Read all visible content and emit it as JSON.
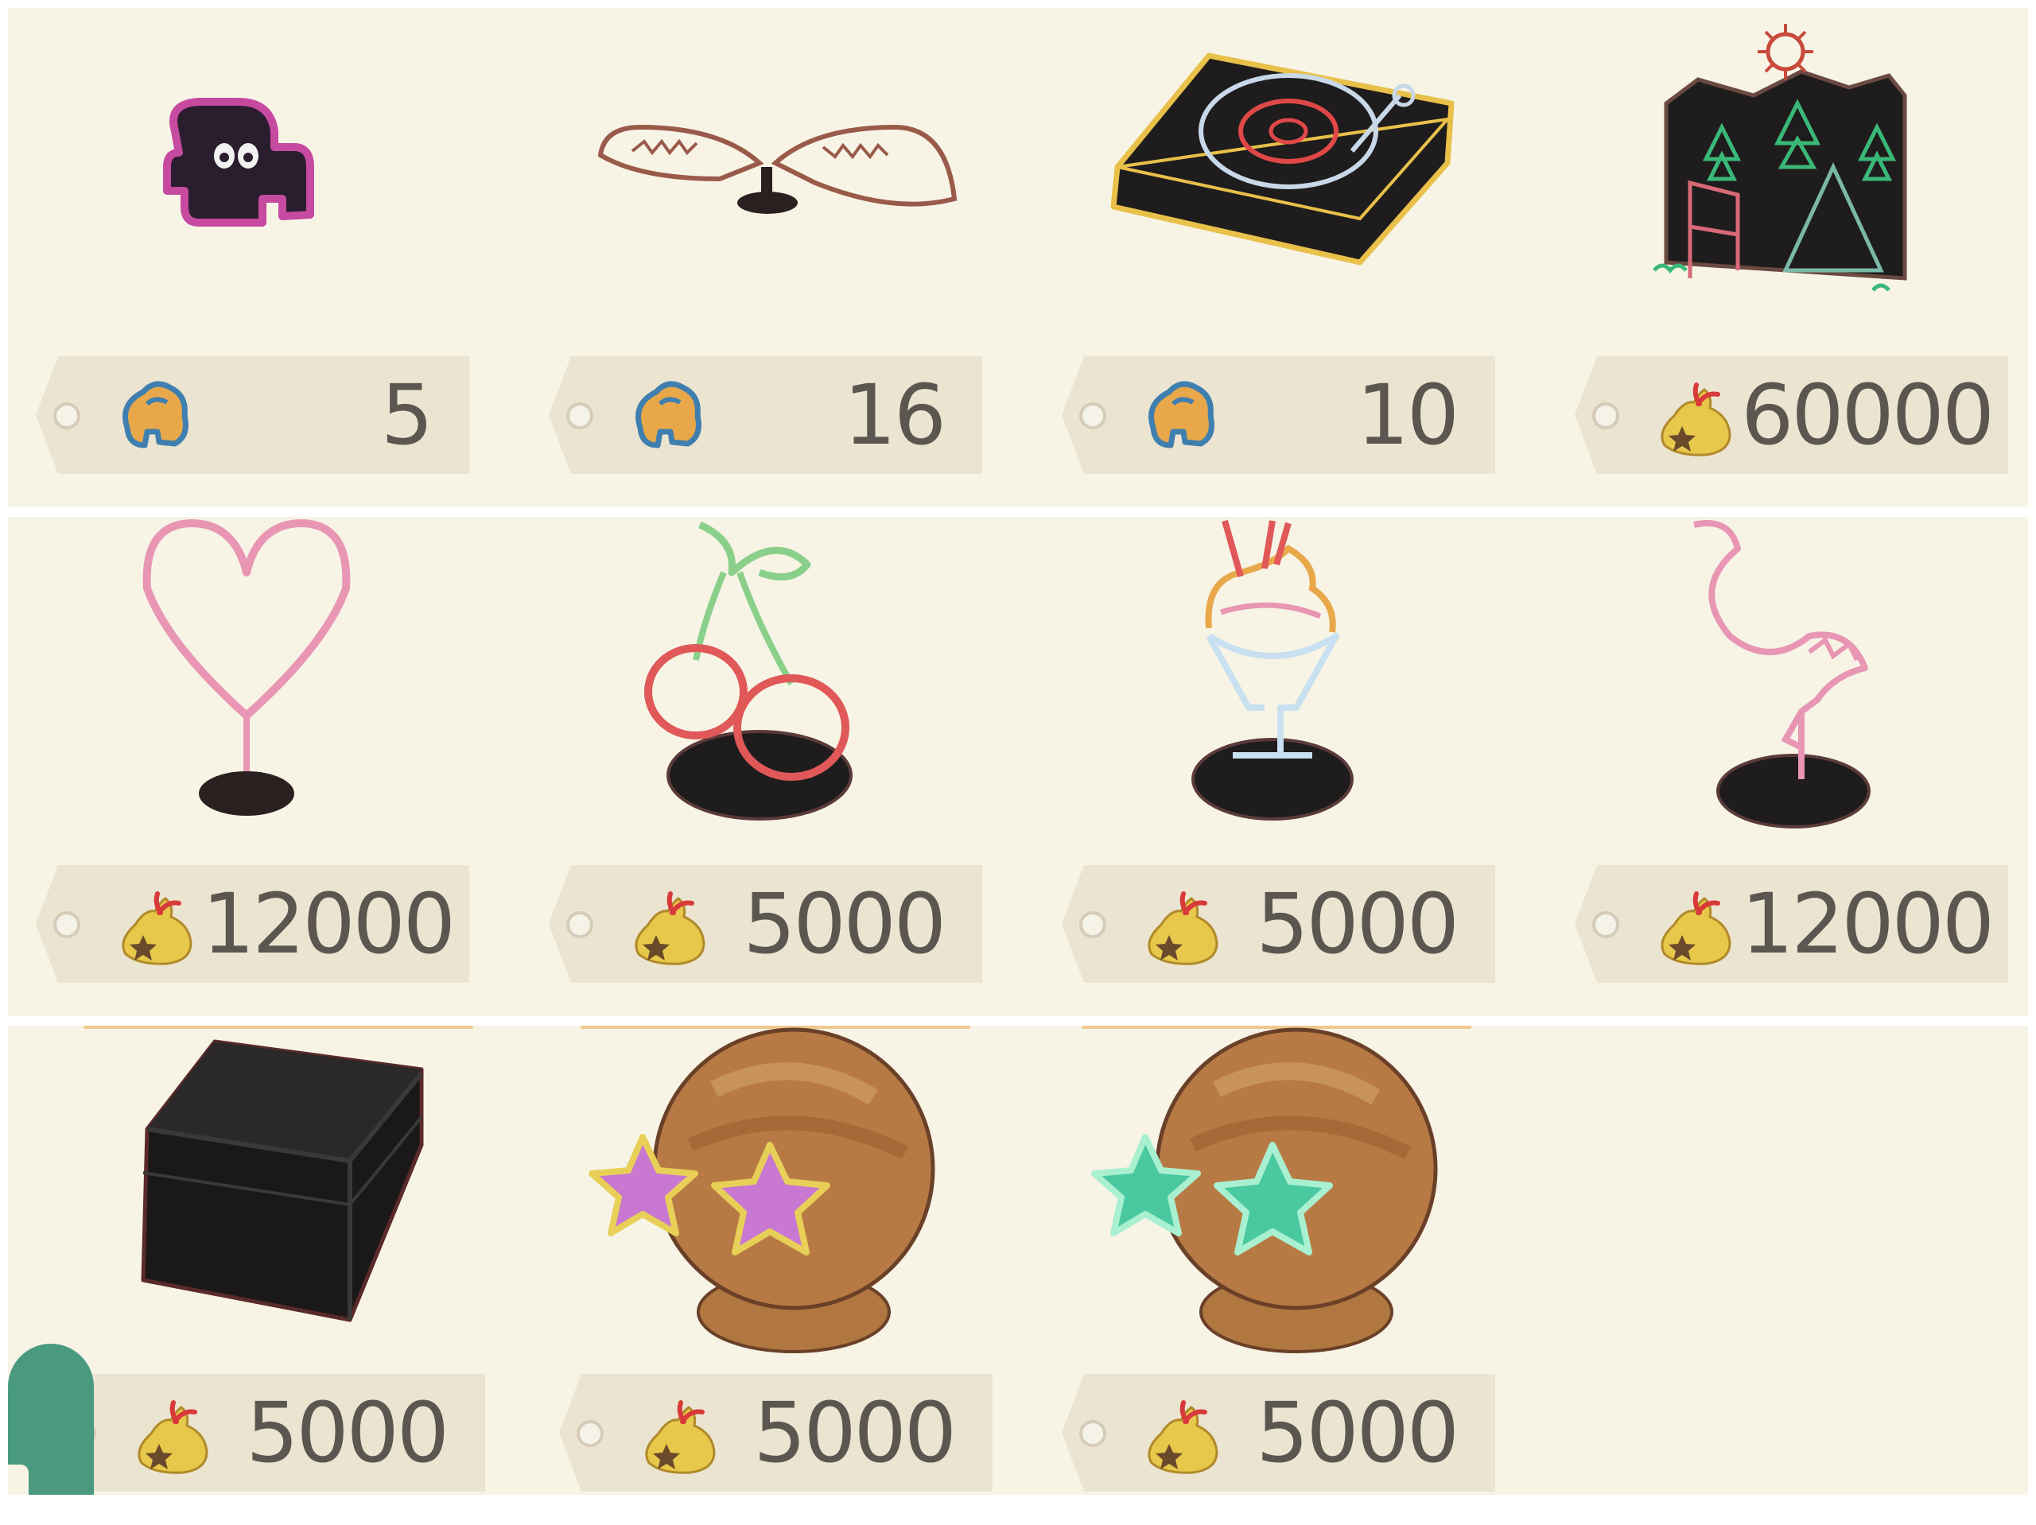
{
  "rows": [
    {
      "items": [
        {
          "item_icon": "neon-ghost-icon",
          "currency_icon": "nook-miles-icon",
          "price": "5"
        },
        {
          "item_icon": "neon-wings-icon",
          "currency_icon": "nook-miles-icon",
          "price": "16"
        },
        {
          "item_icon": "neon-turntable-icon",
          "currency_icon": "nook-miles-icon",
          "price": "10"
        },
        {
          "item_icon": "neon-camping-scene-icon",
          "currency_icon": "bells-bag-icon",
          "price": "60000"
        }
      ]
    },
    {
      "items": [
        {
          "item_icon": "neon-heart-icon",
          "currency_icon": "bells-bag-icon",
          "price": "12000"
        },
        {
          "item_icon": "neon-cherry-icon",
          "currency_icon": "bells-bag-icon",
          "price": "5000"
        },
        {
          "item_icon": "neon-parfait-icon",
          "currency_icon": "bells-bag-icon",
          "price": "5000"
        },
        {
          "item_icon": "neon-flamingo-icon",
          "currency_icon": "bells-bag-icon",
          "price": "12000"
        }
      ]
    },
    {
      "items": [
        {
          "item_icon": "black-box-icon",
          "currency_icon": "bells-bag-icon",
          "price": "5000"
        },
        {
          "item_icon": "pink-star-glasses-head-icon",
          "currency_icon": "bells-bag-icon",
          "price": "5000"
        },
        {
          "item_icon": "green-star-glasses-head-icon",
          "currency_icon": "bells-bag-icon",
          "price": "5000"
        }
      ]
    }
  ],
  "colors": {
    "background": "#f7f4e6",
    "tag": "#ebe4d1",
    "price_text": "#5c5650",
    "corner_badge": "#4a9a80"
  }
}
